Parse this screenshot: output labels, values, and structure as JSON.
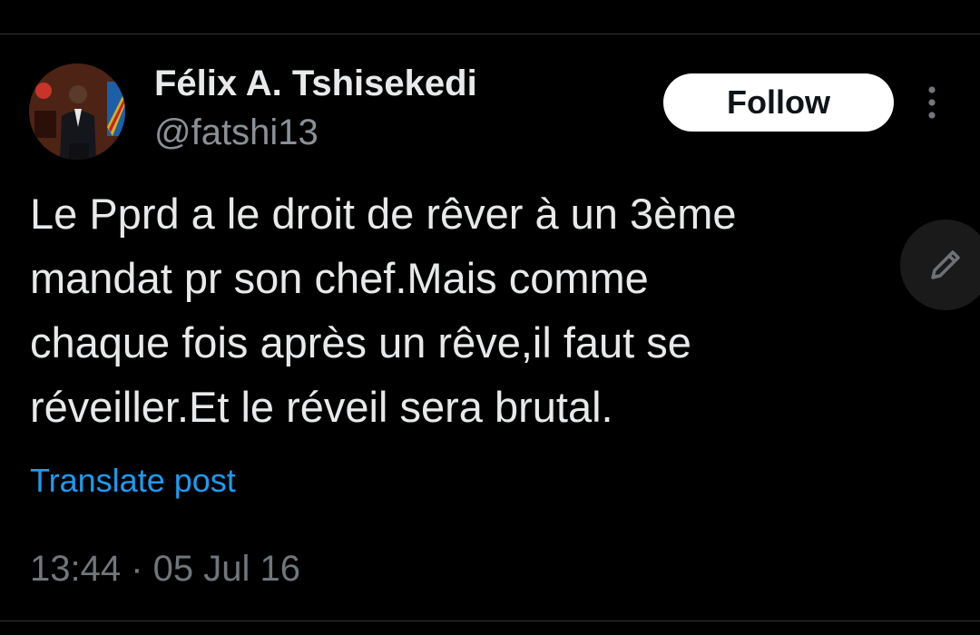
{
  "author": {
    "display_name": "Félix A. Tshisekedi",
    "handle": "@fatshi13"
  },
  "actions": {
    "follow_label": "Follow",
    "more_icon": "more-vertical-icon",
    "compose_icon": "pencil-icon"
  },
  "post": {
    "text": "Le Pprd a le droit de rêver à un 3ème\nmandat pr son chef.Mais comme\nchaque fois après un rêve,il faut se\nréveiller.Et le réveil sera brutal.",
    "translate_label": "Translate post",
    "timestamp": "13:44 · 05 Jul 16"
  },
  "colors": {
    "background": "#000000",
    "text_primary": "#e7e9ea",
    "text_secondary": "#71767b",
    "link": "#1d9bf0",
    "follow_bg": "#ffffff"
  }
}
